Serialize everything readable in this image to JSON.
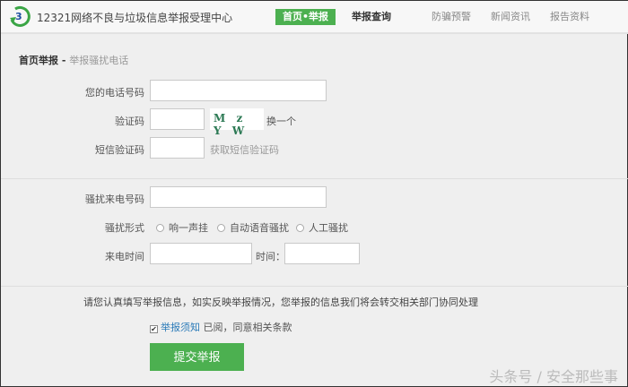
{
  "header": {
    "site_title": "12321网络不良与垃圾信息举报受理中心",
    "nav": [
      "首页•举报",
      "举报查询",
      "防骗预警",
      "新闻资讯",
      "报告资料"
    ]
  },
  "breadcrumb": {
    "home": "首页举报",
    "separator": "-",
    "current": "举报骚扰电话"
  },
  "form": {
    "phone_label": "您的电话号码",
    "phone_value": "",
    "captcha_label": "验证码",
    "captcha_value": "",
    "captcha_text": "M z Y W",
    "captcha_refresh": "换一个",
    "sms_label": "短信验证码",
    "sms_value": "",
    "sms_get": "获取短信验证码",
    "harass_label": "骚扰来电号码",
    "harass_value": "",
    "type_label": "骚扰形式",
    "type_options": [
      "响一声挂",
      "自动语音骚扰",
      "人工骚扰"
    ],
    "time_label": "来电时间",
    "date_value": "",
    "time_sub_label": "时间：",
    "time_value": ""
  },
  "notice": "请您认真填写举报信息，如实反映举报情况，您举报的信息我们将会转交相关部门协同处理",
  "agree": {
    "checked": true,
    "link": "举报须知",
    "text": "已阅，同意相关条款"
  },
  "submit_label": "提交举报",
  "watermark": "头条号 / 安全那些事"
}
